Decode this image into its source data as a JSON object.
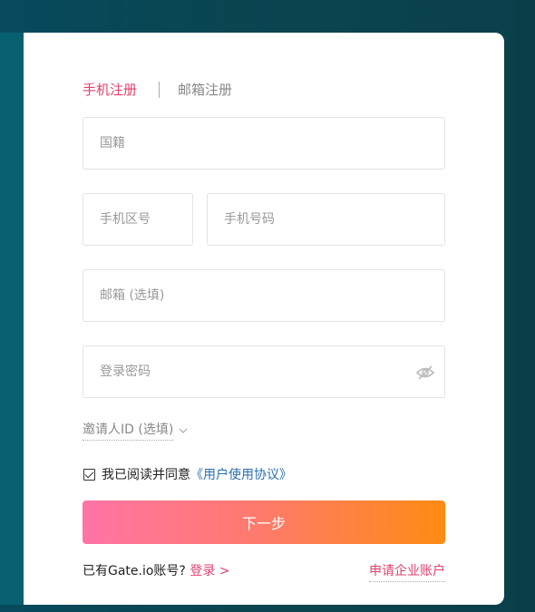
{
  "tabs": {
    "phone": "手机注册",
    "email": "邮箱注册"
  },
  "fields": {
    "nationality_placeholder": "国籍",
    "area_code_placeholder": "手机区号",
    "phone_placeholder": "手机号码",
    "email_optional_placeholder": "邮箱 (选填)",
    "password_placeholder": "登录密码"
  },
  "inviter": {
    "label": "邀请人ID (选填)"
  },
  "agreement": {
    "checked": true,
    "prefix": "我已阅读并同意",
    "link": "《用户使用协议》"
  },
  "buttons": {
    "next": "下一步"
  },
  "footer": {
    "have_account": "已有Gate.io账号?",
    "login": "登录 >",
    "enterprise": "申请企业账户"
  },
  "colors": {
    "accent": "#e0416d",
    "button_gradient_start": "#ff74a6",
    "button_gradient_end": "#ff8a12",
    "link_blue": "#2a6fb0"
  }
}
